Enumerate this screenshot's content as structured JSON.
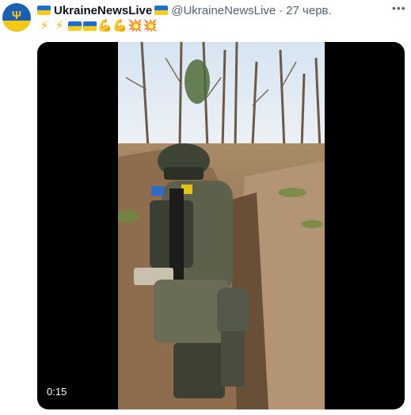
{
  "tweet": {
    "display_name": "UkraineNewsLive",
    "handle": "@UkraineNewsLive",
    "separator": "·",
    "date": "27 черв.",
    "text_emojis": [
      "⚡",
      "⚡",
      "flag",
      "flag",
      "💪",
      "💪",
      "💥",
      "💥"
    ],
    "more_glyph": "•••"
  },
  "media": {
    "type": "video",
    "duration": "0:15"
  },
  "colors": {
    "flag_blue": "#1f6fd0",
    "flag_yellow": "#f7cd1a",
    "secondary_text": "#536471"
  }
}
